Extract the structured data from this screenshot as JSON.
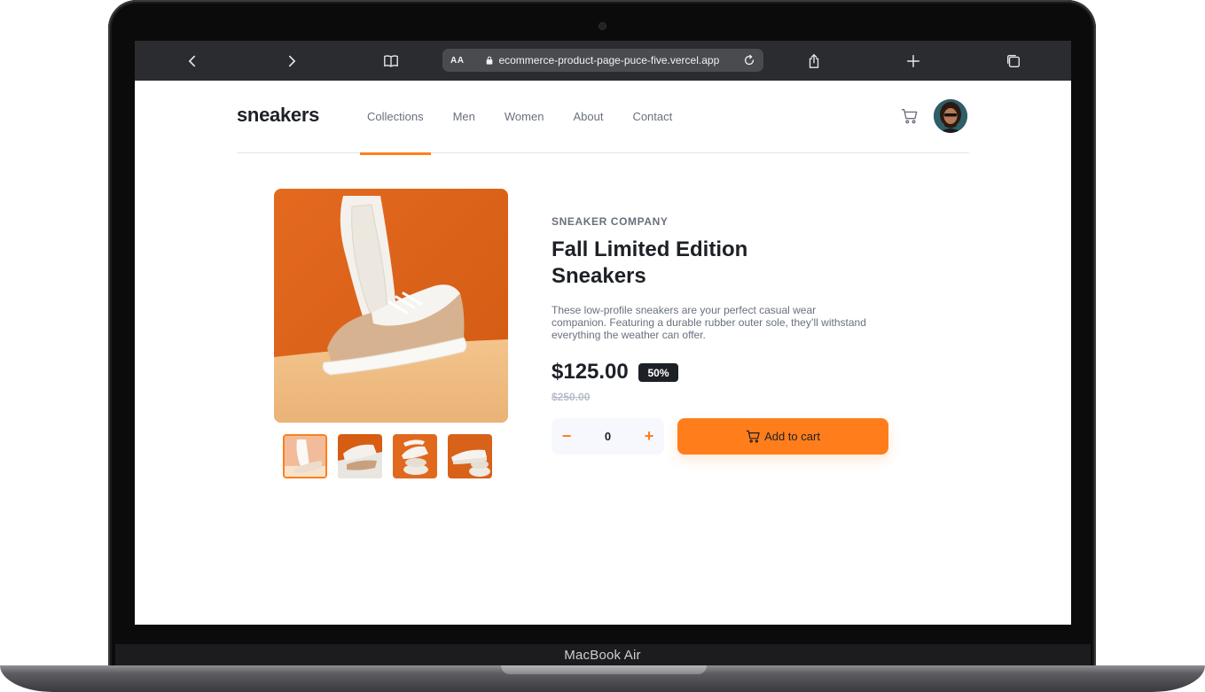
{
  "device": {
    "label": "MacBook Air"
  },
  "browser": {
    "url_prefix": "AA",
    "url": "ecommerce-product-page-puce-five.vercel.app",
    "icons": [
      "back-icon",
      "forward-icon",
      "book-icon",
      "lock-icon",
      "reload-icon",
      "share-icon",
      "new-tab-icon",
      "tabs-icon"
    ]
  },
  "site": {
    "logo": "sneakers",
    "nav": [
      "Collections",
      "Men",
      "Women",
      "About",
      "Contact"
    ],
    "active_nav": "Collections"
  },
  "product": {
    "company": "SNEAKER COMPANY",
    "title": "Fall Limited Edition Sneakers",
    "description": "These low-profile sneakers are your perfect casual wear companion. Featuring a durable rubber outer sole, they’ll withstand everything the weather can offer.",
    "price": "$125.00",
    "discount": "50%",
    "old_price": "$250.00",
    "quantity": "0",
    "minus_label": "−",
    "plus_label": "+",
    "add_to_cart": "Add to cart"
  },
  "colors": {
    "accent": "#ff7e1b",
    "dark": "#1d2026",
    "muted": "#69707d"
  }
}
